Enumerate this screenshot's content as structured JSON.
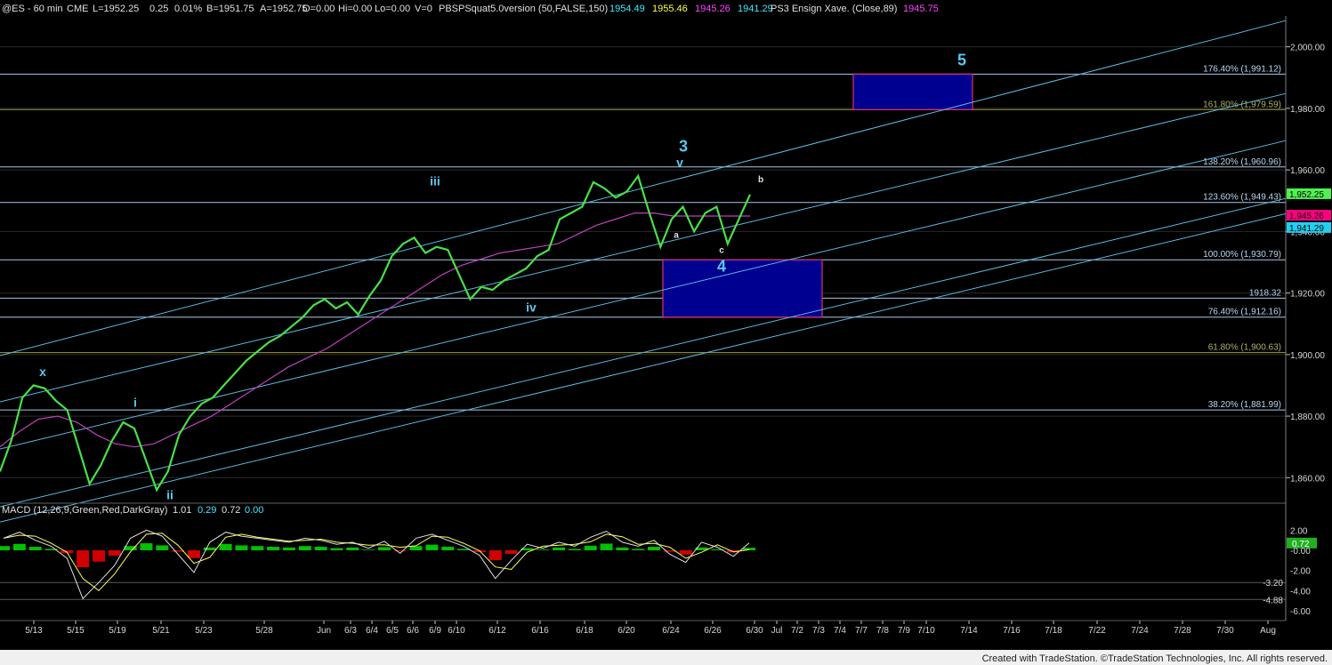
{
  "header": {
    "symbol": "@ES - 60 min",
    "exchange": "CME",
    "last": "L=1952.25",
    "change": "0.25",
    "change_pct": "0.01%",
    "bid": "B=1951.75",
    "ask": "A=1952.75",
    "open": "O=0.00",
    "high": "Hi=0.00",
    "low": "Lo=0.00",
    "volume": "V=0",
    "study1": "PBSPSquat5.0version (50,FALSE,150)",
    "study1_values": [
      "1954.49",
      "1955.46",
      "1945.26",
      "1941.29"
    ],
    "study2": "PS3 Ensign Xave. (Close,89)",
    "study2_value": "1945.75"
  },
  "macd_header": {
    "label": "MACD (12,26,9,Green,Red,DarkGray)",
    "values": [
      "1.01",
      "0.29",
      "0.72",
      "0.00"
    ]
  },
  "colors": {
    "price": "#48e048",
    "xave": "#c040c0",
    "channel": "#5ab8e0",
    "wave": "#58c8f0",
    "box_fill": "#000090",
    "box_border": "#e03070",
    "macd_green": "#00c000",
    "macd_red": "#d00000"
  },
  "chart_data": {
    "type": "line",
    "title": "@ES - 60 min",
    "y_range": [
      1852,
      2010
    ],
    "y_ticks": [
      "2,000.00",
      "1,980.00",
      "1,960.00",
      "1,940.00",
      "1,920.00",
      "1,900.00",
      "1,880.00",
      "1,860.00"
    ],
    "x_ticks": [
      "5/13",
      "5/15",
      "5/19",
      "5/21",
      "5/23",
      "5/28",
      "Jun",
      "6/3",
      "6/4",
      "6/5",
      "6/6",
      "6/9",
      "6/10",
      "6/12",
      "6/16",
      "6/18",
      "6/20",
      "6/24",
      "6/26",
      "6/30",
      "Jul",
      "7/2",
      "7/3",
      "7/4",
      "7/7",
      "7/8",
      "7/9",
      "7/10",
      "7/14",
      "7/16",
      "7/18",
      "7/22",
      "7/24",
      "7/28",
      "7/30",
      "Aug"
    ],
    "price_series": [
      1862,
      1872,
      1886,
      1890,
      1889,
      1885,
      1882,
      1870,
      1858,
      1864,
      1872,
      1878,
      1876,
      1866,
      1856,
      1862,
      1874,
      1880,
      1884,
      1886,
      1890,
      1894,
      1898,
      1901,
      1904,
      1906,
      1909,
      1912,
      1916,
      1918,
      1915,
      1917,
      1913,
      1919,
      1924,
      1932,
      1936,
      1938,
      1933,
      1935,
      1934,
      1926,
      1918,
      1922,
      1921,
      1924,
      1926,
      1928,
      1932,
      1934,
      1944,
      1946,
      1948,
      1956,
      1954,
      1951,
      1953,
      1958,
      1946,
      1935,
      1944,
      1948,
      1940,
      1946,
      1948,
      1936,
      1944,
      1952
    ],
    "xave_series": [
      1870,
      1875,
      1879,
      1880,
      1878,
      1874,
      1871,
      1870,
      1871,
      1874,
      1877,
      1880,
      1884,
      1888,
      1892,
      1896,
      1899,
      1902,
      1906,
      1910,
      1914,
      1918,
      1922,
      1926,
      1929,
      1931,
      1933,
      1934,
      1935,
      1936,
      1939,
      1942,
      1944,
      1946,
      1946,
      1945,
      1945,
      1945,
      1945,
      1945
    ],
    "fib_levels": [
      {
        "label": "176.40% (1,991.12)",
        "value": 1991.12
      },
      {
        "label": "161.80% (1,979.59)",
        "value": 1979.59
      },
      {
        "label": "138.20% (1,960.96)",
        "value": 1960.96
      },
      {
        "label": "123.60% (1,949.43)",
        "value": 1949.43
      },
      {
        "label": "100.00% (1,930.79)",
        "value": 1930.79
      },
      {
        "label": "1918.32",
        "value": 1918.32
      },
      {
        "label": "76.40% (1,912.16)",
        "value": 1912.16
      },
      {
        "label": "61.80% (1,900.63)",
        "value": 1900.63
      },
      {
        "label": "38.20% (1,881.99)",
        "value": 1881.99
      }
    ],
    "price_tags": [
      {
        "label": "1,952.25",
        "value": 1952.25,
        "bg": "#50f050"
      },
      {
        "label": "1,945.26",
        "value": 1945.26,
        "bg": "#ff0080"
      },
      {
        "label": "1,941.29",
        "value": 1941.29,
        "bg": "#20d0f0"
      }
    ],
    "wave_labels": [
      {
        "label": "x",
        "x_tick": "5/13",
        "value": 1893
      },
      {
        "label": "i",
        "x_tick": "5/19",
        "value": 1883
      },
      {
        "label": "ii",
        "x_tick": "5/21",
        "value": 1853
      },
      {
        "label": "iii",
        "x_tick": "6/9",
        "value": 1955
      },
      {
        "label": "iv",
        "x_tick": "6/12",
        "value": 1914
      },
      {
        "label": "3",
        "x_tick": "6/24",
        "value": 1966
      },
      {
        "label": "v",
        "x_tick": "6/24",
        "value": 1961
      },
      {
        "label": "a",
        "x_tick": "6/24",
        "value": 1938
      },
      {
        "label": "b",
        "x_tick": "6/26",
        "value": 1956
      },
      {
        "label": "c",
        "x_tick": "6/26",
        "value": 1933
      },
      {
        "label": "4",
        "x_tick": "6/26",
        "value": 1927
      },
      {
        "label": "5",
        "x_tick": "7/14",
        "value": 1994
      }
    ],
    "target_boxes": [
      {
        "name": "wave-5-target",
        "from_tick": "7/7",
        "to_tick": "7/14",
        "low": 1979.59,
        "high": 1991.12
      },
      {
        "name": "wave-4-support",
        "from_tick": "6/24",
        "to_tick": "7/3",
        "low": 1912.16,
        "high": 1930.79
      }
    ],
    "macd": {
      "y_ticks": [
        "2.00",
        "0.72",
        "-0.00",
        "-2.00",
        "-3.20",
        "-4.00",
        "-4.88",
        "-6.00"
      ],
      "y_range": [
        -6.8,
        3.0
      ],
      "values": [
        1.2,
        1.8,
        1.0,
        0.4,
        -0.8,
        -4.8,
        -3.2,
        -1.5,
        1.2,
        2.0,
        1.4,
        -0.4,
        -2.2,
        0.8,
        1.8,
        1.4,
        1.2,
        1.0,
        0.8,
        1.2,
        1.0,
        0.6,
        0.8,
        0.2,
        0.9,
        -0.3,
        1.2,
        1.6,
        1.0,
        0.4,
        -0.5,
        -2.8,
        -1.0,
        0.6,
        0.2,
        0.8,
        0.4,
        1.3,
        1.9,
        0.8,
        0.4,
        1.0,
        -0.4,
        -1.2,
        0.8,
        0.3,
        -0.6,
        0.72
      ]
    }
  },
  "footer": {
    "credit": "Created with TradeStation. ©TradeStation Technologies, Inc. All rights reserved."
  }
}
